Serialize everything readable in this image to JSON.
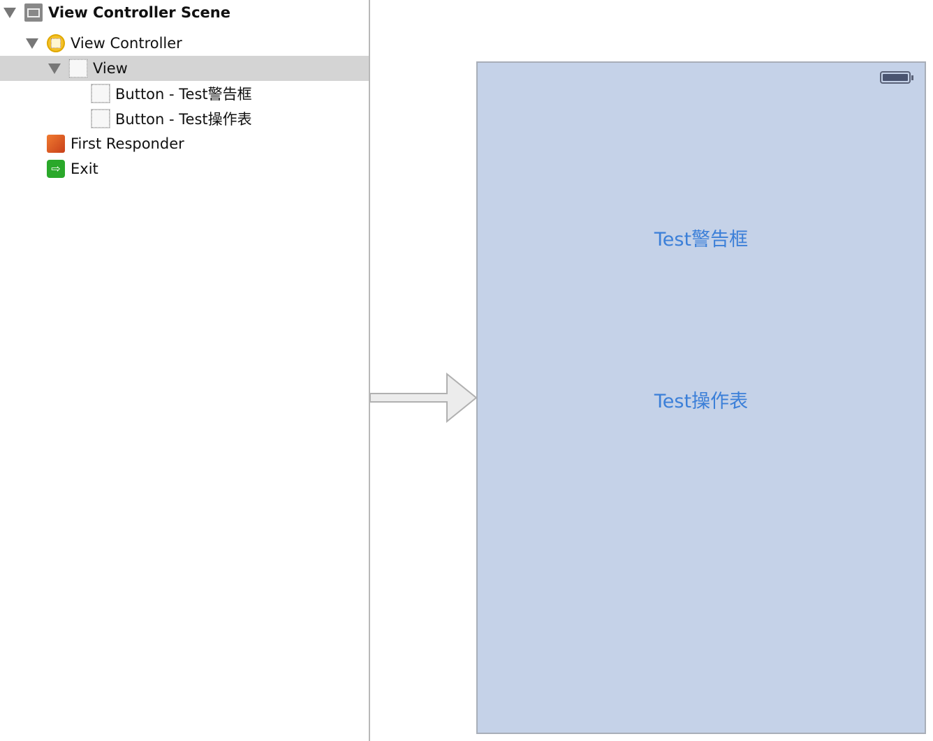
{
  "outline": {
    "items": [
      {
        "label": "View Controller Scene",
        "icon": "scene-icon"
      },
      {
        "label": "View Controller",
        "icon": "view-controller-icon"
      },
      {
        "label": "View",
        "icon": "view-icon",
        "selected": true
      },
      {
        "label": "Button - Test警告框",
        "icon": "button-icon"
      },
      {
        "label": "Button - Test操作表",
        "icon": "button-icon"
      },
      {
        "label": "First Responder",
        "icon": "first-responder-icon"
      },
      {
        "label": "Exit",
        "icon": "exit-icon"
      }
    ]
  },
  "canvas": {
    "background": "#c5d2e8",
    "buttons": [
      {
        "label": "Test警告框"
      },
      {
        "label": "Test操作表"
      }
    ],
    "button_color": "#3b7fd8"
  }
}
